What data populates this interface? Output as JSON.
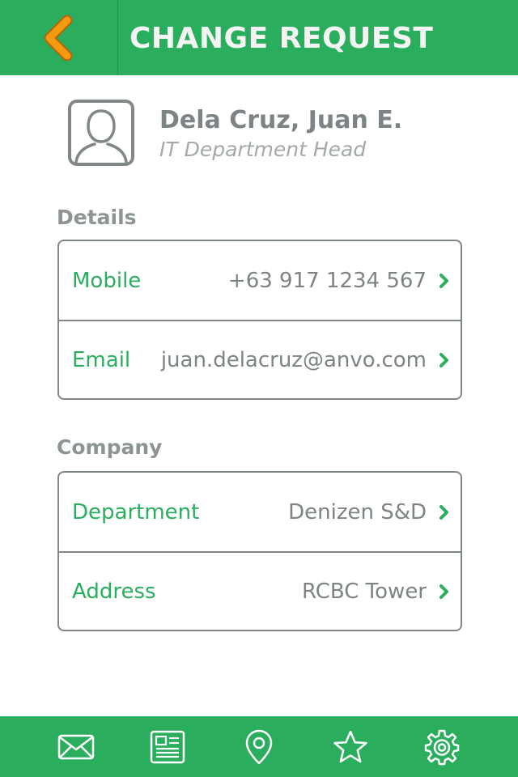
{
  "header": {
    "title": "CHANGE REQUEST",
    "back_icon": "chevron-left-icon",
    "back_color": "#f39c12"
  },
  "profile": {
    "name": "Dela Cruz, Juan E.",
    "title": "IT Department Head",
    "avatar_icon": "person-avatar-icon"
  },
  "details": {
    "heading": "Details",
    "rows": [
      {
        "label": "Mobile",
        "value": "+63 917 1234 567"
      },
      {
        "label": "Email",
        "value": "juan.delacruz@anvo.com"
      }
    ]
  },
  "company": {
    "heading": "Company",
    "rows": [
      {
        "label": "Department",
        "value": "Denizen S&D"
      },
      {
        "label": "Address",
        "value": "RCBC Tower"
      }
    ]
  },
  "tabbar": {
    "items": [
      {
        "icon": "envelope-icon"
      },
      {
        "icon": "newspaper-icon"
      },
      {
        "icon": "map-pin-icon"
      },
      {
        "icon": "star-icon"
      },
      {
        "icon": "gear-icon"
      }
    ]
  },
  "colors": {
    "accent": "#2aae5e",
    "back_arrow": "#f39c12",
    "text": "#7d8485",
    "border": "#7f8788"
  }
}
